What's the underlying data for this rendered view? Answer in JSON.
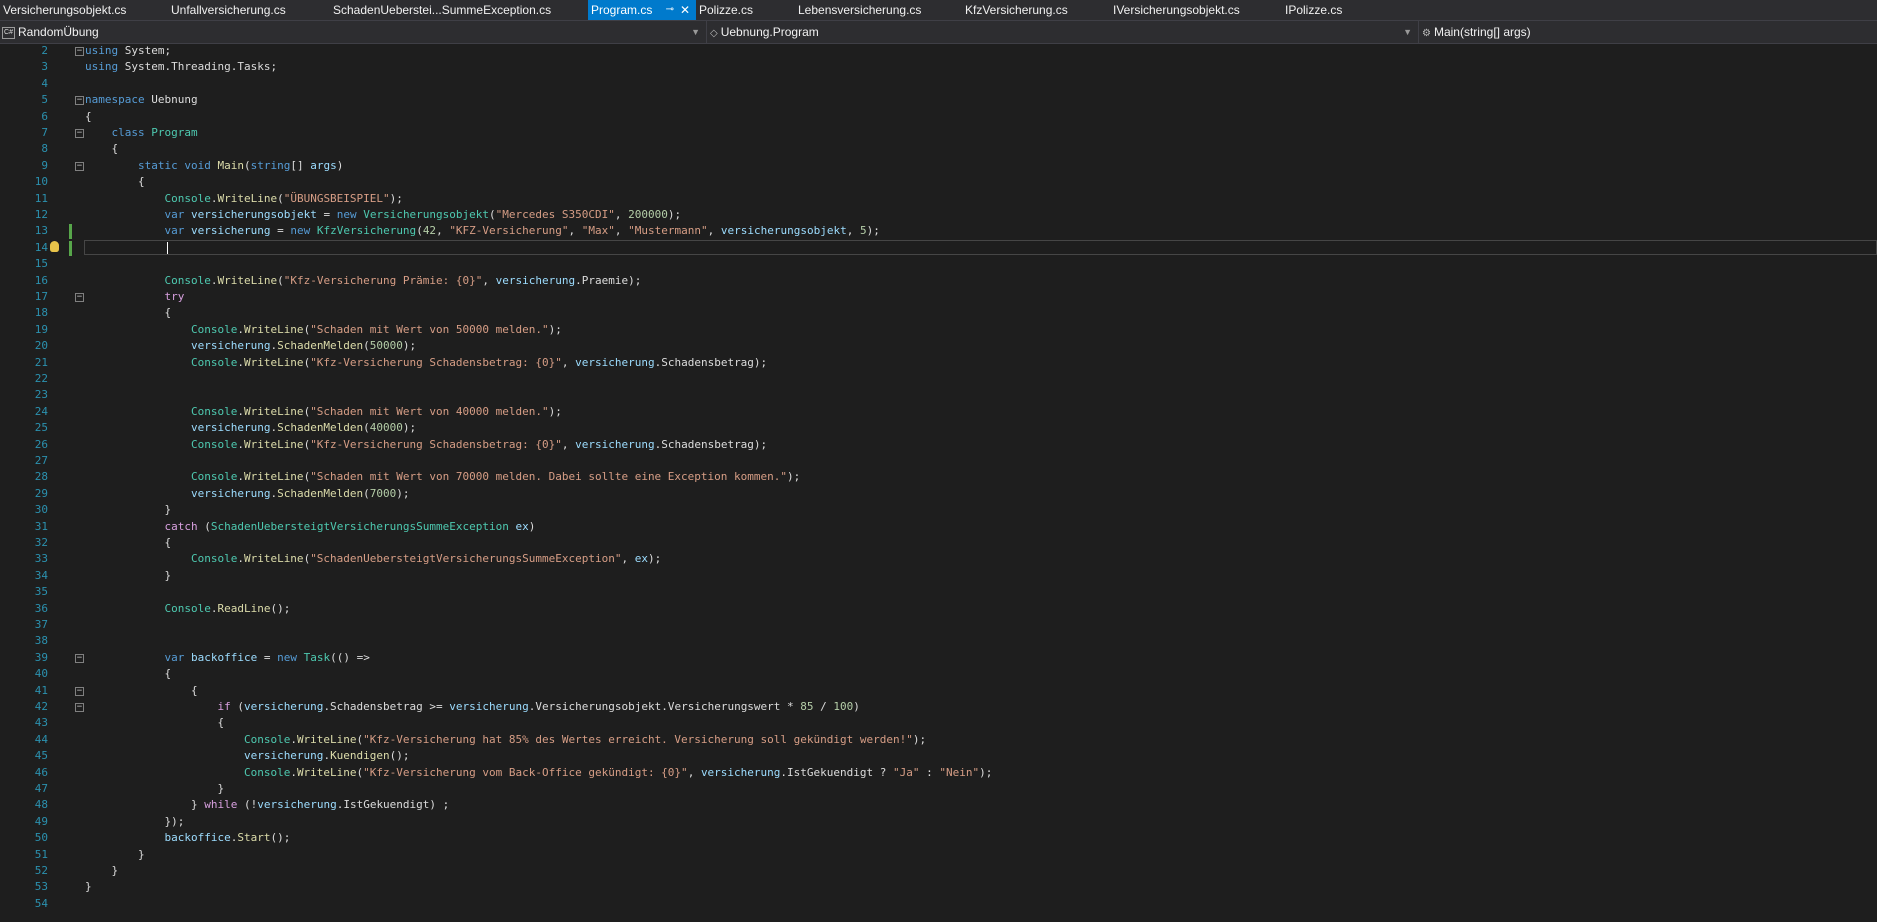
{
  "tabs": [
    {
      "label": "Versicherungsobjekt.cs",
      "active": false
    },
    {
      "label": "Unfallversicherung.cs",
      "active": false
    },
    {
      "label": "SchadenUeberstei...SummeException.cs",
      "active": false
    },
    {
      "label": "Program.cs",
      "active": true
    },
    {
      "label": "Polizze.cs",
      "active": false
    },
    {
      "label": "Lebensversicherung.cs",
      "active": false
    },
    {
      "label": "KfzVersicherung.cs",
      "active": false
    },
    {
      "label": "IVersicherungsobjekt.cs",
      "active": false
    },
    {
      "label": "IPolizze.cs",
      "active": false
    }
  ],
  "navbar": {
    "project": "RandomÜbung",
    "project_icon": "C#",
    "type": "Uebnung.Program",
    "member": "Main(string[] args)"
  },
  "colors": {
    "keyword": "#569cd6",
    "control": "#d8a0df",
    "type": "#4ec9b0",
    "method": "#dcdcaa",
    "string": "#d69d85",
    "number": "#b5cea8",
    "variable": "#9cdcfe",
    "plain": "#dcdcdc",
    "linenum": "#2b91af"
  },
  "editor": {
    "current_line": 14,
    "lines": [
      {
        "n": "2",
        "fold": "minus",
        "t": [
          [
            "kw",
            "using"
          ],
          [
            "pl",
            " System;"
          ]
        ]
      },
      {
        "n": "3",
        "t": [
          [
            "kw",
            "using"
          ],
          [
            "pl",
            " System.Threading.Tasks;"
          ]
        ]
      },
      {
        "n": "4",
        "t": []
      },
      {
        "n": "5",
        "fold": "minus",
        "t": [
          [
            "kw",
            "namespace"
          ],
          [
            "pl",
            " Uebnung"
          ]
        ]
      },
      {
        "n": "6",
        "t": [
          [
            "pl",
            "{"
          ]
        ]
      },
      {
        "n": "7",
        "fold": "minus",
        "t": [
          [
            "pl",
            "    "
          ],
          [
            "kw",
            "class"
          ],
          [
            "pl",
            " "
          ],
          [
            "ty",
            "Program"
          ]
        ]
      },
      {
        "n": "8",
        "t": [
          [
            "pl",
            "    {"
          ]
        ]
      },
      {
        "n": "9",
        "fold": "minus",
        "t": [
          [
            "pl",
            "        "
          ],
          [
            "kw",
            "static"
          ],
          [
            "pl",
            " "
          ],
          [
            "kw",
            "void"
          ],
          [
            "pl",
            " "
          ],
          [
            "me",
            "Main"
          ],
          [
            "pl",
            "("
          ],
          [
            "kw",
            "string"
          ],
          [
            "pl",
            "[] "
          ],
          [
            "va",
            "args"
          ],
          [
            "pl",
            ")"
          ]
        ]
      },
      {
        "n": "10",
        "t": [
          [
            "pl",
            "        {"
          ]
        ]
      },
      {
        "n": "11",
        "t": [
          [
            "pl",
            "            "
          ],
          [
            "ty",
            "Console"
          ],
          [
            "pl",
            "."
          ],
          [
            "me",
            "WriteLine"
          ],
          [
            "pl",
            "("
          ],
          [
            "st",
            "\"ÜBUNGSBEISPIEL\""
          ],
          [
            "pl",
            ");"
          ]
        ]
      },
      {
        "n": "12",
        "t": [
          [
            "pl",
            "            "
          ],
          [
            "kw",
            "var"
          ],
          [
            "pl",
            " "
          ],
          [
            "va",
            "versicherungsobjekt"
          ],
          [
            "pl",
            " = "
          ],
          [
            "kw",
            "new"
          ],
          [
            "pl",
            " "
          ],
          [
            "ty",
            "Versicherungsobjekt"
          ],
          [
            "pl",
            "("
          ],
          [
            "st",
            "\"Mercedes S350CDI\""
          ],
          [
            "pl",
            ", "
          ],
          [
            "nu",
            "200000"
          ],
          [
            "pl",
            ");"
          ]
        ]
      },
      {
        "n": "13",
        "t": [
          [
            "pl",
            "            "
          ],
          [
            "kw",
            "var"
          ],
          [
            "pl",
            " "
          ],
          [
            "va",
            "versicherung"
          ],
          [
            "pl",
            " = "
          ],
          [
            "kw",
            "new"
          ],
          [
            "pl",
            " "
          ],
          [
            "ty",
            "KfzVersicherung"
          ],
          [
            "pl",
            "("
          ],
          [
            "nu",
            "42"
          ],
          [
            "pl",
            ", "
          ],
          [
            "st",
            "\"KFZ-Versicherung\""
          ],
          [
            "pl",
            ", "
          ],
          [
            "st",
            "\"Max\""
          ],
          [
            "pl",
            ", "
          ],
          [
            "st",
            "\"Mustermann\""
          ],
          [
            "pl",
            ", "
          ],
          [
            "va",
            "versicherungsobjekt"
          ],
          [
            "pl",
            ", "
          ],
          [
            "nu",
            "5"
          ],
          [
            "pl",
            ");"
          ]
        ]
      },
      {
        "n": "14",
        "t": []
      },
      {
        "n": "15",
        "t": []
      },
      {
        "n": "16",
        "t": [
          [
            "pl",
            "            "
          ],
          [
            "ty",
            "Console"
          ],
          [
            "pl",
            "."
          ],
          [
            "me",
            "WriteLine"
          ],
          [
            "pl",
            "("
          ],
          [
            "st",
            "\"Kfz-Versicherung Prämie: {0}\""
          ],
          [
            "pl",
            ", "
          ],
          [
            "va",
            "versicherung"
          ],
          [
            "pl",
            ".Praemie);"
          ]
        ]
      },
      {
        "n": "17",
        "fold": "minus",
        "t": [
          [
            "pl",
            "            "
          ],
          [
            "kw2",
            "try"
          ]
        ]
      },
      {
        "n": "18",
        "t": [
          [
            "pl",
            "            {"
          ]
        ]
      },
      {
        "n": "19",
        "t": [
          [
            "pl",
            "                "
          ],
          [
            "ty",
            "Console"
          ],
          [
            "pl",
            "."
          ],
          [
            "me",
            "WriteLine"
          ],
          [
            "pl",
            "("
          ],
          [
            "st",
            "\"Schaden mit Wert von 50000 melden.\""
          ],
          [
            "pl",
            ");"
          ]
        ]
      },
      {
        "n": "20",
        "t": [
          [
            "pl",
            "                "
          ],
          [
            "va",
            "versicherung"
          ],
          [
            "pl",
            "."
          ],
          [
            "me",
            "SchadenMelden"
          ],
          [
            "pl",
            "("
          ],
          [
            "nu",
            "50000"
          ],
          [
            "pl",
            ");"
          ]
        ]
      },
      {
        "n": "21",
        "t": [
          [
            "pl",
            "                "
          ],
          [
            "ty",
            "Console"
          ],
          [
            "pl",
            "."
          ],
          [
            "me",
            "WriteLine"
          ],
          [
            "pl",
            "("
          ],
          [
            "st",
            "\"Kfz-Versicherung Schadensbetrag: {0}\""
          ],
          [
            "pl",
            ", "
          ],
          [
            "va",
            "versicherung"
          ],
          [
            "pl",
            ".Schadensbetrag);"
          ]
        ]
      },
      {
        "n": "22",
        "t": []
      },
      {
        "n": "23",
        "t": []
      },
      {
        "n": "24",
        "t": [
          [
            "pl",
            "                "
          ],
          [
            "ty",
            "Console"
          ],
          [
            "pl",
            "."
          ],
          [
            "me",
            "WriteLine"
          ],
          [
            "pl",
            "("
          ],
          [
            "st",
            "\"Schaden mit Wert von 40000 melden.\""
          ],
          [
            "pl",
            ");"
          ]
        ]
      },
      {
        "n": "25",
        "t": [
          [
            "pl",
            "                "
          ],
          [
            "va",
            "versicherung"
          ],
          [
            "pl",
            "."
          ],
          [
            "me",
            "SchadenMelden"
          ],
          [
            "pl",
            "("
          ],
          [
            "nu",
            "40000"
          ],
          [
            "pl",
            ");"
          ]
        ]
      },
      {
        "n": "26",
        "t": [
          [
            "pl",
            "                "
          ],
          [
            "ty",
            "Console"
          ],
          [
            "pl",
            "."
          ],
          [
            "me",
            "WriteLine"
          ],
          [
            "pl",
            "("
          ],
          [
            "st",
            "\"Kfz-Versicherung Schadensbetrag: {0}\""
          ],
          [
            "pl",
            ", "
          ],
          [
            "va",
            "versicherung"
          ],
          [
            "pl",
            ".Schadensbetrag);"
          ]
        ]
      },
      {
        "n": "27",
        "t": []
      },
      {
        "n": "28",
        "t": [
          [
            "pl",
            "                "
          ],
          [
            "ty",
            "Console"
          ],
          [
            "pl",
            "."
          ],
          [
            "me",
            "WriteLine"
          ],
          [
            "pl",
            "("
          ],
          [
            "st",
            "\"Schaden mit Wert von 70000 melden. Dabei sollte eine Exception kommen.\""
          ],
          [
            "pl",
            ");"
          ]
        ]
      },
      {
        "n": "29",
        "t": [
          [
            "pl",
            "                "
          ],
          [
            "va",
            "versicherung"
          ],
          [
            "pl",
            "."
          ],
          [
            "me",
            "SchadenMelden"
          ],
          [
            "pl",
            "("
          ],
          [
            "nu",
            "7000"
          ],
          [
            "pl",
            ");"
          ]
        ]
      },
      {
        "n": "30",
        "t": [
          [
            "pl",
            "            }"
          ]
        ]
      },
      {
        "n": "31",
        "t": [
          [
            "pl",
            "            "
          ],
          [
            "kw2",
            "catch"
          ],
          [
            "pl",
            " ("
          ],
          [
            "ty",
            "SchadenUebersteigtVersicherungsSummeException"
          ],
          [
            "pl",
            " "
          ],
          [
            "va",
            "ex"
          ],
          [
            "pl",
            ")"
          ]
        ]
      },
      {
        "n": "32",
        "t": [
          [
            "pl",
            "            {"
          ]
        ]
      },
      {
        "n": "33",
        "t": [
          [
            "pl",
            "                "
          ],
          [
            "ty",
            "Console"
          ],
          [
            "pl",
            "."
          ],
          [
            "me",
            "WriteLine"
          ],
          [
            "pl",
            "("
          ],
          [
            "st",
            "\"SchadenUebersteigtVersicherungsSummeException\""
          ],
          [
            "pl",
            ", "
          ],
          [
            "va",
            "ex"
          ],
          [
            "pl",
            ");"
          ]
        ]
      },
      {
        "n": "34",
        "t": [
          [
            "pl",
            "            }"
          ]
        ]
      },
      {
        "n": "35",
        "t": []
      },
      {
        "n": "36",
        "t": [
          [
            "pl",
            "            "
          ],
          [
            "ty",
            "Console"
          ],
          [
            "pl",
            "."
          ],
          [
            "me",
            "ReadLine"
          ],
          [
            "pl",
            "();"
          ]
        ]
      },
      {
        "n": "37",
        "t": []
      },
      {
        "n": "38",
        "t": []
      },
      {
        "n": "39",
        "fold": "minus",
        "t": [
          [
            "pl",
            "            "
          ],
          [
            "kw",
            "var"
          ],
          [
            "pl",
            " "
          ],
          [
            "va",
            "backoffice"
          ],
          [
            "pl",
            " = "
          ],
          [
            "kw",
            "new"
          ],
          [
            "pl",
            " "
          ],
          [
            "ty",
            "Task"
          ],
          [
            "pl",
            "(() =>"
          ]
        ]
      },
      {
        "n": "40",
        "t": [
          [
            "pl",
            "            {"
          ]
        ]
      },
      {
        "n": "41",
        "fold": "minus",
        "t": [
          [
            "pl",
            "                {"
          ]
        ]
      },
      {
        "n": "42",
        "fold": "minus",
        "t": [
          [
            "pl",
            "                    "
          ],
          [
            "kw2",
            "if"
          ],
          [
            "pl",
            " ("
          ],
          [
            "va",
            "versicherung"
          ],
          [
            "pl",
            ".Schadensbetrag >= "
          ],
          [
            "va",
            "versicherung"
          ],
          [
            "pl",
            ".Versicherungsobjekt.Versicherungswert * "
          ],
          [
            "nu",
            "85"
          ],
          [
            "pl",
            " / "
          ],
          [
            "nu",
            "100"
          ],
          [
            "pl",
            ")"
          ]
        ]
      },
      {
        "n": "43",
        "t": [
          [
            "pl",
            "                    {"
          ]
        ]
      },
      {
        "n": "44",
        "t": [
          [
            "pl",
            "                        "
          ],
          [
            "ty",
            "Console"
          ],
          [
            "pl",
            "."
          ],
          [
            "me",
            "WriteLine"
          ],
          [
            "pl",
            "("
          ],
          [
            "st",
            "\"Kfz-Versicherung hat 85% des Wertes erreicht. Versicherung soll gekündigt werden!\""
          ],
          [
            "pl",
            ");"
          ]
        ]
      },
      {
        "n": "45",
        "t": [
          [
            "pl",
            "                        "
          ],
          [
            "va",
            "versicherung"
          ],
          [
            "pl",
            "."
          ],
          [
            "me",
            "Kuendigen"
          ],
          [
            "pl",
            "();"
          ]
        ]
      },
      {
        "n": "46",
        "t": [
          [
            "pl",
            "                        "
          ],
          [
            "ty",
            "Console"
          ],
          [
            "pl",
            "."
          ],
          [
            "me",
            "WriteLine"
          ],
          [
            "pl",
            "("
          ],
          [
            "st",
            "\"Kfz-Versicherung vom Back-Office gekündigt: {0}\""
          ],
          [
            "pl",
            ", "
          ],
          [
            "va",
            "versicherung"
          ],
          [
            "pl",
            ".IstGekuendigt ? "
          ],
          [
            "st",
            "\"Ja\""
          ],
          [
            "pl",
            " : "
          ],
          [
            "st",
            "\"Nein\""
          ],
          [
            "pl",
            ");"
          ]
        ]
      },
      {
        "n": "47",
        "t": [
          [
            "pl",
            "                    }"
          ]
        ]
      },
      {
        "n": "48",
        "t": [
          [
            "pl",
            "                } "
          ],
          [
            "kw2",
            "while"
          ],
          [
            "pl",
            " (!"
          ],
          [
            "va",
            "versicherung"
          ],
          [
            "pl",
            ".IstGekuendigt) ;"
          ]
        ]
      },
      {
        "n": "49",
        "t": [
          [
            "pl",
            "            });"
          ]
        ]
      },
      {
        "n": "50",
        "t": [
          [
            "pl",
            "            "
          ],
          [
            "va",
            "backoffice"
          ],
          [
            "pl",
            "."
          ],
          [
            "me",
            "Start"
          ],
          [
            "pl",
            "();"
          ]
        ]
      },
      {
        "n": "51",
        "t": [
          [
            "pl",
            "        }"
          ]
        ]
      },
      {
        "n": "52",
        "t": [
          [
            "pl",
            "    }"
          ]
        ]
      },
      {
        "n": "53",
        "t": [
          [
            "pl",
            "}"
          ]
        ]
      },
      {
        "n": "54",
        "t": []
      }
    ]
  }
}
